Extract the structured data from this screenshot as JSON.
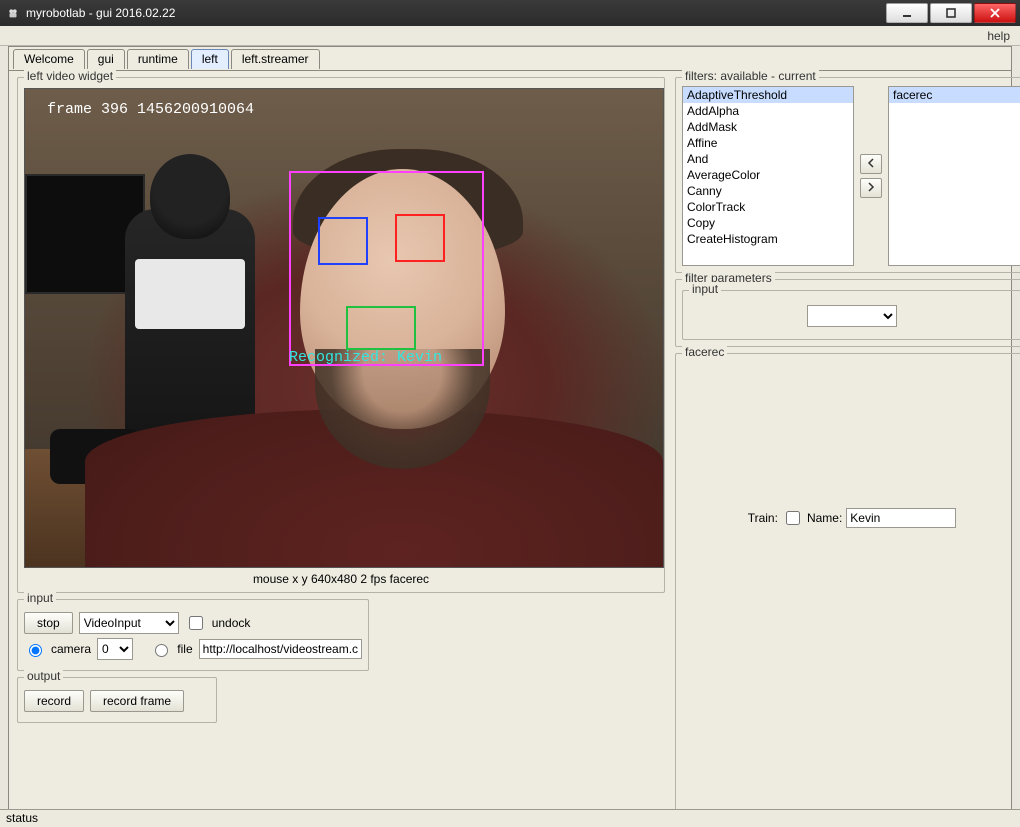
{
  "window": {
    "title": "myrobotlab - gui 2016.02.22"
  },
  "menubar": {
    "help": "help"
  },
  "tabs": [
    "Welcome",
    "gui",
    "runtime",
    "left",
    "left.streamer"
  ],
  "active_tab_index": 3,
  "video_widget": {
    "legend": "left  video widget",
    "frame_text": "frame 396 1456200910064",
    "recognized_text": "Recognized: Kevin",
    "caption": "mouse x y  640x480  2 fps  facerec"
  },
  "input_group": {
    "legend": "input",
    "stop_btn": "stop",
    "source_select": "VideoInput",
    "undock_label": "undock",
    "camera_label": "camera",
    "camera_index": "0",
    "file_label": "file",
    "file_url": "http://localhost/videostream.cgi"
  },
  "output_group": {
    "legend": "output",
    "record_btn": "record",
    "record_frame_btn": "record frame"
  },
  "filters_group": {
    "legend": "filters: available - current",
    "available": [
      "AdaptiveThreshold",
      "AddAlpha",
      "AddMask",
      "Affine",
      "And",
      "AverageColor",
      "Canny",
      "ColorTrack",
      "Copy",
      "CreateHistogram"
    ],
    "selected_available_index": 0,
    "current": [
      "facerec"
    ],
    "selected_current_index": 0
  },
  "filter_parameters": {
    "legend": "filter parameters",
    "input_legend": "input",
    "input_value": ""
  },
  "facerec_group": {
    "legend": "facerec",
    "train_label": "Train:",
    "name_label": "Name:",
    "name_value": "Kevin"
  },
  "status": {
    "label": "status"
  }
}
